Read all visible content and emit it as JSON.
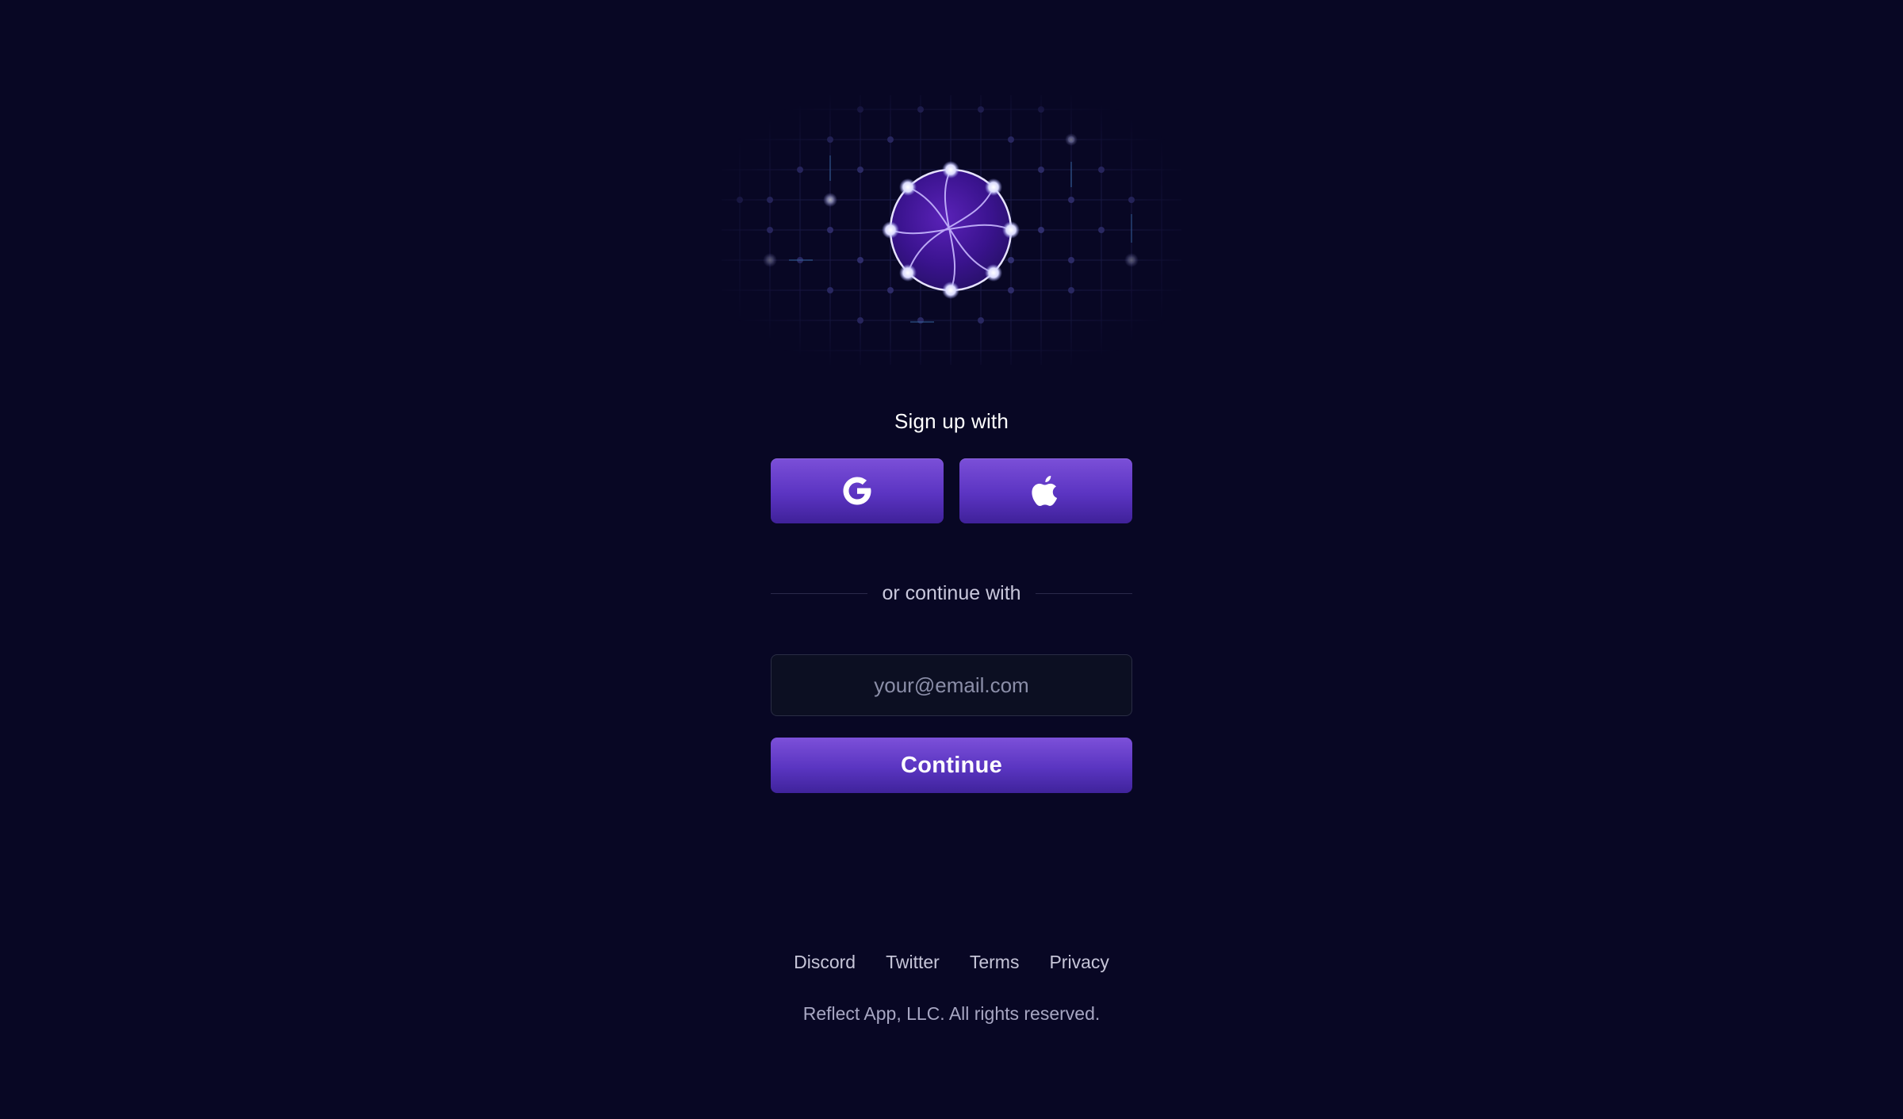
{
  "auth": {
    "signup_heading": "Sign up with",
    "providers": [
      {
        "name": "Google",
        "icon": "google-icon"
      },
      {
        "name": "Apple",
        "icon": "apple-icon"
      }
    ],
    "divider_text": "or continue with",
    "email_placeholder": "your@email.com",
    "email_value": "",
    "continue_label": "Continue"
  },
  "footer": {
    "links": [
      "Discord",
      "Twitter",
      "Terms",
      "Privacy"
    ],
    "copyright": "Reflect App, LLC. All rights reserved."
  },
  "colors": {
    "background": "#080724",
    "button_top": "#7b4fd8",
    "button_bottom": "#3f2199",
    "input_background": "#0c0f22",
    "input_border": "#2a2d44",
    "muted_text": "#c6c5d8"
  }
}
